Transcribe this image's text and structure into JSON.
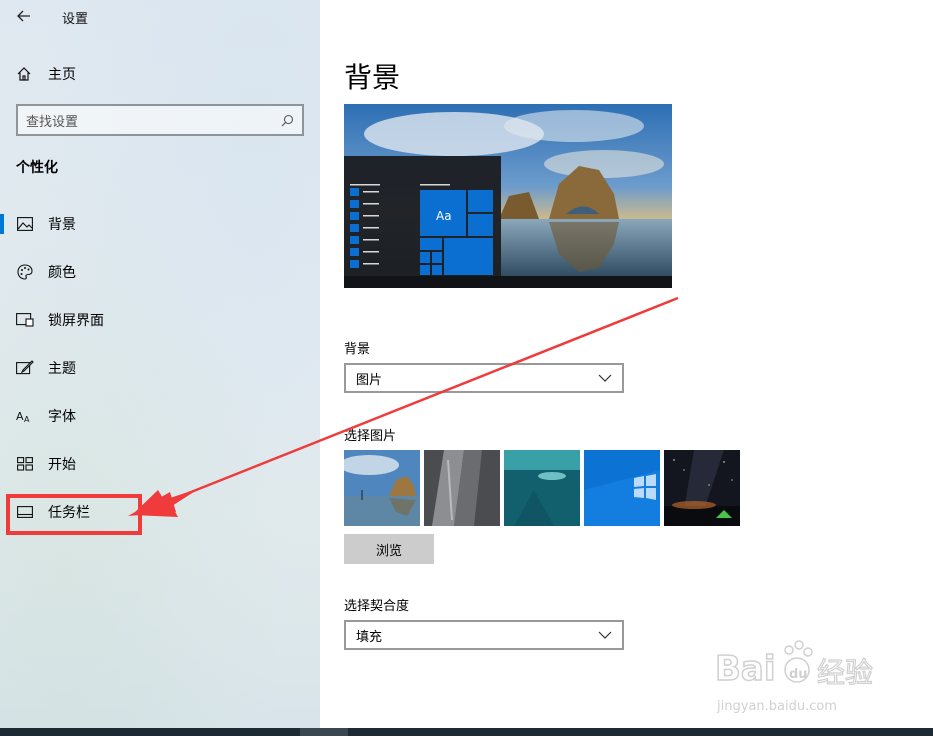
{
  "window": {
    "title": "设置"
  },
  "sidebar": {
    "home_label": "主页",
    "search_placeholder": "查找设置",
    "section_title": "个性化",
    "items": [
      {
        "label": "背景",
        "icon": "picture-icon",
        "active": true
      },
      {
        "label": "颜色",
        "icon": "palette-icon",
        "active": false
      },
      {
        "label": "锁屏界面",
        "icon": "lock-screen-icon",
        "active": false
      },
      {
        "label": "主题",
        "icon": "theme-brush-icon",
        "active": false
      },
      {
        "label": "字体",
        "icon": "font-icon",
        "active": false
      },
      {
        "label": "开始",
        "icon": "start-grid-icon",
        "active": false
      },
      {
        "label": "任务栏",
        "icon": "taskbar-icon",
        "active": false
      }
    ]
  },
  "main": {
    "title": "背景",
    "preview": {
      "sample_text": "Aa"
    },
    "background_label": "背景",
    "background_value": "图片",
    "choose_picture_label": "选择图片",
    "browse_label": "浏览",
    "fit_label": "选择契合度",
    "fit_value": "填充"
  },
  "watermark": {
    "brand": "Bai",
    "paw": "du",
    "cn": "经验",
    "url": "jingyan.baidu.com"
  },
  "colors": {
    "accent": "#0078d7",
    "annotation": "#ef3b3b"
  }
}
